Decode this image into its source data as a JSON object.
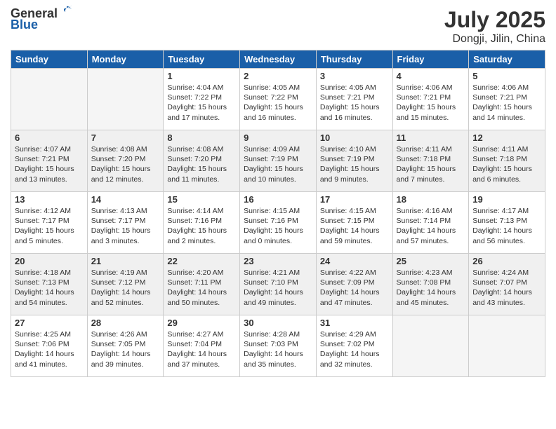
{
  "header": {
    "logo_general": "General",
    "logo_blue": "Blue",
    "month": "July 2025",
    "location": "Dongji, Jilin, China"
  },
  "days_of_week": [
    "Sunday",
    "Monday",
    "Tuesday",
    "Wednesday",
    "Thursday",
    "Friday",
    "Saturday"
  ],
  "weeks": [
    [
      {
        "day": null
      },
      {
        "day": null
      },
      {
        "day": 1,
        "sunrise": "4:04 AM",
        "sunset": "7:22 PM",
        "daylight": "15 hours and 17 minutes."
      },
      {
        "day": 2,
        "sunrise": "4:05 AM",
        "sunset": "7:22 PM",
        "daylight": "15 hours and 16 minutes."
      },
      {
        "day": 3,
        "sunrise": "4:05 AM",
        "sunset": "7:21 PM",
        "daylight": "15 hours and 16 minutes."
      },
      {
        "day": 4,
        "sunrise": "4:06 AM",
        "sunset": "7:21 PM",
        "daylight": "15 hours and 15 minutes."
      },
      {
        "day": 5,
        "sunrise": "4:06 AM",
        "sunset": "7:21 PM",
        "daylight": "15 hours and 14 minutes."
      }
    ],
    [
      {
        "day": 6,
        "sunrise": "4:07 AM",
        "sunset": "7:21 PM",
        "daylight": "15 hours and 13 minutes."
      },
      {
        "day": 7,
        "sunrise": "4:08 AM",
        "sunset": "7:20 PM",
        "daylight": "15 hours and 12 minutes."
      },
      {
        "day": 8,
        "sunrise": "4:08 AM",
        "sunset": "7:20 PM",
        "daylight": "15 hours and 11 minutes."
      },
      {
        "day": 9,
        "sunrise": "4:09 AM",
        "sunset": "7:19 PM",
        "daylight": "15 hours and 10 minutes."
      },
      {
        "day": 10,
        "sunrise": "4:10 AM",
        "sunset": "7:19 PM",
        "daylight": "15 hours and 9 minutes."
      },
      {
        "day": 11,
        "sunrise": "4:11 AM",
        "sunset": "7:18 PM",
        "daylight": "15 hours and 7 minutes."
      },
      {
        "day": 12,
        "sunrise": "4:11 AM",
        "sunset": "7:18 PM",
        "daylight": "15 hours and 6 minutes."
      }
    ],
    [
      {
        "day": 13,
        "sunrise": "4:12 AM",
        "sunset": "7:17 PM",
        "daylight": "15 hours and 5 minutes."
      },
      {
        "day": 14,
        "sunrise": "4:13 AM",
        "sunset": "7:17 PM",
        "daylight": "15 hours and 3 minutes."
      },
      {
        "day": 15,
        "sunrise": "4:14 AM",
        "sunset": "7:16 PM",
        "daylight": "15 hours and 2 minutes."
      },
      {
        "day": 16,
        "sunrise": "4:15 AM",
        "sunset": "7:16 PM",
        "daylight": "15 hours and 0 minutes."
      },
      {
        "day": 17,
        "sunrise": "4:15 AM",
        "sunset": "7:15 PM",
        "daylight": "14 hours and 59 minutes."
      },
      {
        "day": 18,
        "sunrise": "4:16 AM",
        "sunset": "7:14 PM",
        "daylight": "14 hours and 57 minutes."
      },
      {
        "day": 19,
        "sunrise": "4:17 AM",
        "sunset": "7:13 PM",
        "daylight": "14 hours and 56 minutes."
      }
    ],
    [
      {
        "day": 20,
        "sunrise": "4:18 AM",
        "sunset": "7:13 PM",
        "daylight": "14 hours and 54 minutes."
      },
      {
        "day": 21,
        "sunrise": "4:19 AM",
        "sunset": "7:12 PM",
        "daylight": "14 hours and 52 minutes."
      },
      {
        "day": 22,
        "sunrise": "4:20 AM",
        "sunset": "7:11 PM",
        "daylight": "14 hours and 50 minutes."
      },
      {
        "day": 23,
        "sunrise": "4:21 AM",
        "sunset": "7:10 PM",
        "daylight": "14 hours and 49 minutes."
      },
      {
        "day": 24,
        "sunrise": "4:22 AM",
        "sunset": "7:09 PM",
        "daylight": "14 hours and 47 minutes."
      },
      {
        "day": 25,
        "sunrise": "4:23 AM",
        "sunset": "7:08 PM",
        "daylight": "14 hours and 45 minutes."
      },
      {
        "day": 26,
        "sunrise": "4:24 AM",
        "sunset": "7:07 PM",
        "daylight": "14 hours and 43 minutes."
      }
    ],
    [
      {
        "day": 27,
        "sunrise": "4:25 AM",
        "sunset": "7:06 PM",
        "daylight": "14 hours and 41 minutes."
      },
      {
        "day": 28,
        "sunrise": "4:26 AM",
        "sunset": "7:05 PM",
        "daylight": "14 hours and 39 minutes."
      },
      {
        "day": 29,
        "sunrise": "4:27 AM",
        "sunset": "7:04 PM",
        "daylight": "14 hours and 37 minutes."
      },
      {
        "day": 30,
        "sunrise": "4:28 AM",
        "sunset": "7:03 PM",
        "daylight": "14 hours and 35 minutes."
      },
      {
        "day": 31,
        "sunrise": "4:29 AM",
        "sunset": "7:02 PM",
        "daylight": "14 hours and 32 minutes."
      },
      {
        "day": null
      },
      {
        "day": null
      }
    ]
  ]
}
